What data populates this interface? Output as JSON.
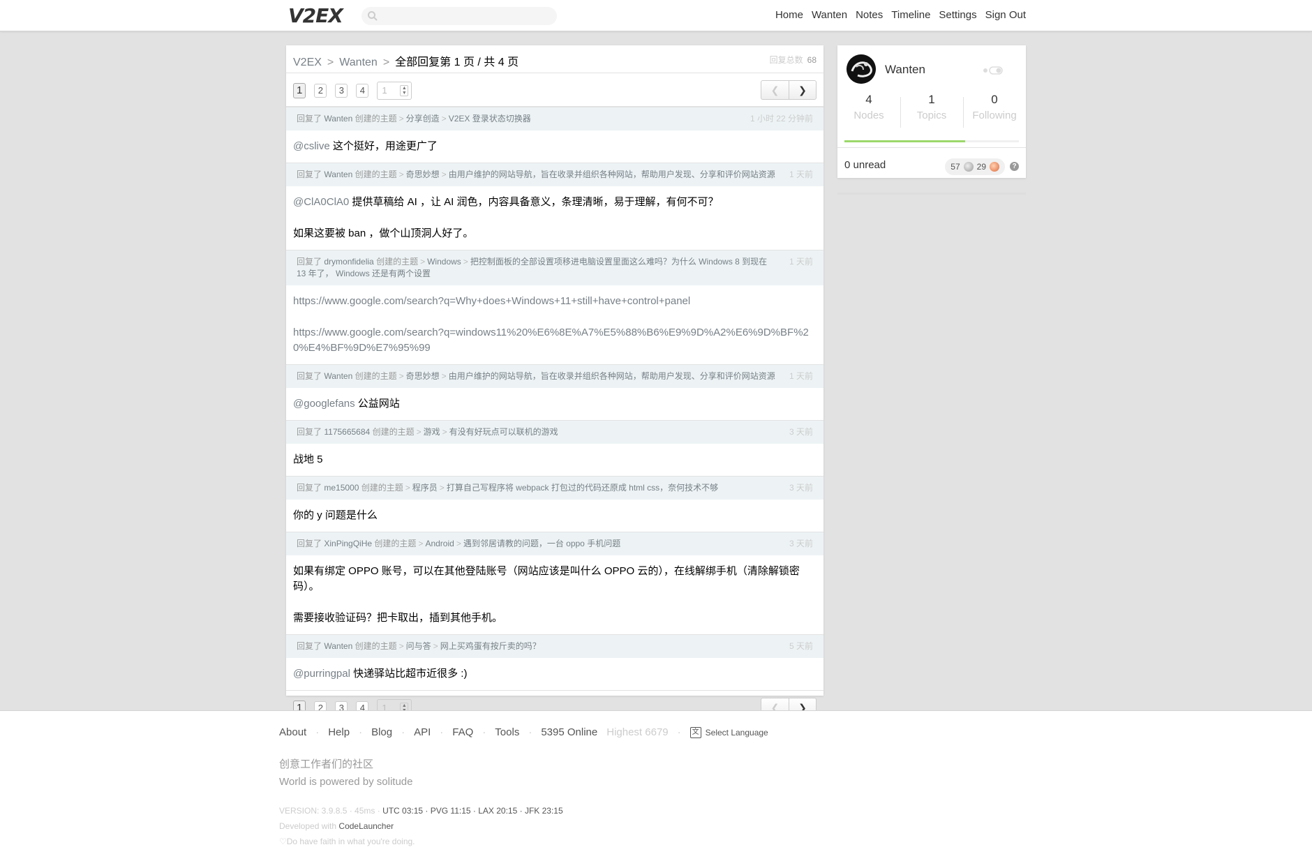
{
  "topbar": {
    "logo": "V2EX",
    "search_placeholder": "",
    "nav": [
      "Home",
      "Wanten",
      "Notes",
      "Timeline",
      "Settings",
      "Sign Out"
    ]
  },
  "breadcrumb": {
    "root": "V2EX",
    "user": "Wanten",
    "current": "全部回复第 1 页 / 共 4 页",
    "total_label": "回复总数",
    "total_value": "68"
  },
  "pager": {
    "pages": [
      "1",
      "2",
      "3",
      "4"
    ],
    "current": "1",
    "input_value": "1",
    "prev": "❮",
    "next": "❯"
  },
  "replies": [
    {
      "prefix": "回复了",
      "author": "Wanten",
      "created": "创建的主题",
      "node": "分享创造",
      "title": "V2EX 登录状态切换器",
      "time": "1 小时 22 分钟前",
      "body": [
        {
          "mention": "@cslive",
          "text": " 这个挺好，用途更广了"
        }
      ]
    },
    {
      "prefix": "回复了",
      "author": "Wanten",
      "created": "创建的主题",
      "node": "奇思妙想",
      "title": "由用户维护的网站导航，旨在收录并组织各种网站，帮助用户发现、分享和评价网站资源",
      "time": "1 天前",
      "body": [
        {
          "mention": "@ClA0ClA0",
          "text": " 提供草稿给 AI ，让 AI 润色，内容具备意义，条理清晰，易于理解，有何不可？"
        },
        {
          "mention": "",
          "text": "如果这要被 ban ，做个山顶洞人好了。"
        }
      ]
    },
    {
      "prefix": "回复了",
      "author": "drymonfidelia",
      "created": "创建的主题",
      "node": "Windows",
      "title": "把控制面板的全部设置项移进电脑设置里面这么难吗？为什么 Windows 8 到现在 13 年了， Windows 还是有两个设置",
      "time": "1 天前",
      "body": [
        {
          "link": "https://www.google.com/search?q=Why+does+Windows+11+still+have+control+panel"
        },
        {
          "link": "https://www.google.com/search?q=windows11%20%E6%8E%A7%E5%88%B6%E9%9D%A2%E6%9D%BF%20%E4%BF%9D%E7%95%99"
        }
      ]
    },
    {
      "prefix": "回复了",
      "author": "Wanten",
      "created": "创建的主题",
      "node": "奇思妙想",
      "title": "由用户维护的网站导航，旨在收录并组织各种网站，帮助用户发现、分享和评价网站资源",
      "time": "1 天前",
      "body": [
        {
          "mention": "@googlefans",
          "text": " 公益网站"
        }
      ]
    },
    {
      "prefix": "回复了",
      "author": "1175665684",
      "created": "创建的主题",
      "node": "游戏",
      "title": "有没有好玩点可以联机的游戏",
      "time": "3 天前",
      "body": [
        {
          "mention": "",
          "text": "战地 5"
        }
      ]
    },
    {
      "prefix": "回复了",
      "author": "me15000",
      "created": "创建的主题",
      "node": "程序员",
      "title": "打算自己写程序将 webpack 打包过的代码还原成 html css，奈何技术不够",
      "time": "3 天前",
      "body": [
        {
          "mention": "",
          "text": "你的 y 问题是什么"
        }
      ]
    },
    {
      "prefix": "回复了",
      "author": "XinPingQiHe",
      "created": "创建的主题",
      "node": "Android",
      "title": "遇到邻居请教的问题，一台 oppo 手机问题",
      "time": "3 天前",
      "body": [
        {
          "mention": "",
          "text": "如果有绑定 OPPO 账号，可以在其他登陆账号（网站应该是叫什么 OPPO 云的），在线解绑手机（清除解锁密码）。"
        },
        {
          "mention": "",
          "text": "需要接收验证码？把卡取出，插到其他手机。"
        }
      ]
    },
    {
      "prefix": "回复了",
      "author": "Wanten",
      "created": "创建的主题",
      "node": "问与答",
      "title": "网上买鸡蛋有按斤卖的吗？",
      "time": "5 天前",
      "body": [
        {
          "mention": "@purringpal",
          "text": " 快递驿站比超市近很多 :)"
        }
      ]
    }
  ],
  "sidebar": {
    "username": "Wanten",
    "stats": [
      {
        "num": "4",
        "label": "Nodes"
      },
      {
        "num": "1",
        "label": "Topics"
      },
      {
        "num": "0",
        "label": "Following"
      }
    ],
    "progress": 0.69,
    "unread": "0 unread",
    "silver": "57",
    "bronze": "29",
    "help": "?"
  },
  "footer": {
    "links": [
      "About",
      "Help",
      "Blog",
      "API",
      "FAQ",
      "Tools"
    ],
    "online": "5395 Online",
    "highest": "Highest 6679",
    "language": "Select Language",
    "slogan1": "创意工作者们的社区",
    "slogan2": "World is powered by solitude",
    "version": "VERSION: 3.9.8.5 · 45ms ·",
    "times": "UTC 03:15 · PVG 11:15 · LAX 20:15 · JFK 23:15",
    "developed_label": "Developed with",
    "developed_with": "CodeLauncher",
    "faith": "♡Do have faith in what you're doing."
  },
  "colors": {
    "link_gray": "#778087",
    "reply_head_bg": "#edf3f5",
    "progress_green": "#9bd86a",
    "page_bg": "#e2e2e2"
  }
}
